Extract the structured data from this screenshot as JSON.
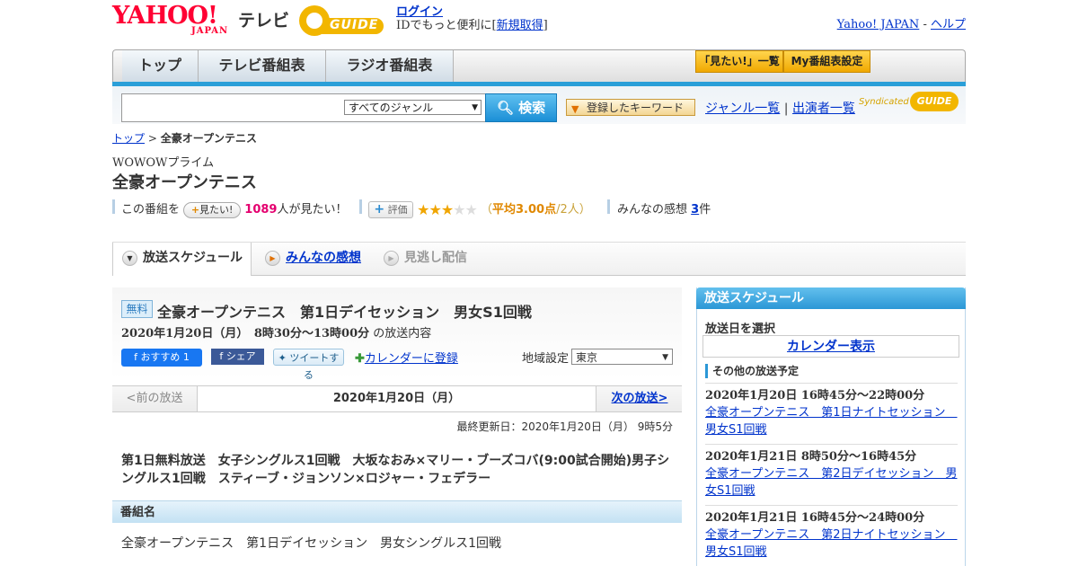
{
  "header": {
    "logo_text": "YAHOO!",
    "logo_sub": "JAPAN",
    "section": "テレビ",
    "gguide_text": "GUIDE",
    "login": "ログイン",
    "login_msg_pre": "IDでもっと便利に[",
    "login_register": "新規取得",
    "login_msg_post": "]",
    "yahoo_japan_link": "Yahoo! JAPAN",
    "separator": "-",
    "help_link": "ヘルプ"
  },
  "nav": {
    "tabs": [
      "トップ",
      "テレビ番組表",
      "ラジオ番組表"
    ],
    "mitai_list": "「見たい!」一覧",
    "my_schedule": "My番組表設定"
  },
  "search": {
    "placeholder": "",
    "genre_select": "すべてのジャンル",
    "search_button": "検索",
    "keyword_button": "登録したキーワード",
    "genre_list": "ジャンル一覧",
    "link_separator": "|",
    "performer_list": "出演者一覧",
    "syndicated": "Syndicated",
    "syndicated_logo": "GUIDE"
  },
  "breadcrumb": {
    "top": "トップ",
    "separator": ">",
    "current": "全豪オープンテニス"
  },
  "program": {
    "channel": "WOWOWプライム",
    "title": "全豪オープンテニス",
    "mitai_prefix": "この番組を",
    "mitai_button": "見たい!",
    "mitai_count": "1089",
    "mitai_suffix": "人が見たい！",
    "rating_button": "評価",
    "rating": 3,
    "rating_max": 5,
    "rating_avg_pre": "（",
    "rating_avg": "平均3.00点",
    "rating_avg_post": "/2人）",
    "comments_prefix": "みんなの感想",
    "comments_count": "3",
    "comments_suffix": "件"
  },
  "tabs": {
    "schedule": "放送スケジュール",
    "impressions": "みんなの感想",
    "missed": "見逃し配信"
  },
  "broadcast": {
    "free_badge": "無料",
    "title": "全豪オープンテニス　第1日デイセッション　男女S1回戦",
    "datetime": "2020年1月20日（月）　8時30分～13時00分",
    "datetime_suffix": "の放送内容",
    "fb_recommend": "おすすめ 1",
    "fb_share": "シェア",
    "tweet": "ツイートする",
    "calendar_register": "カレンダーに登録",
    "region_label": "地域設定",
    "region_value": "東京",
    "prev": "<前の放送",
    "current_date": "2020年1月20日（月）",
    "next": "次の放送>",
    "updated": "最終更新日：2020年1月20日（月）  9時5分",
    "description": "第1日無料放送　女子シングルス1回戦　大坂なおみ×マリー・ブーズコバ(9:00試合開始)男子シングルス1回戦　スティーブ・ジョンソン×ロジャー・フェデラー",
    "section_title": "番組名",
    "section_body": "全豪オープンテニス　第1日デイセッション　男女シングルス1回戦"
  },
  "side": {
    "header": "放送スケジュール",
    "select_date": "放送日を選択",
    "calendar": "カレンダー表示",
    "other_schedule": "その他の放送予定",
    "entries": [
      {
        "date": "2020年1月20日 16時45分～22時00分",
        "title": "全豪オープンテニス　第1日ナイトセッション　男女S1回戦"
      },
      {
        "date": "2020年1月21日 8時50分～16時45分",
        "title": "全豪オープンテニス　第2日デイセッション　男女S1回戦"
      },
      {
        "date": "2020年1月21日 16時45分～24時00分",
        "title": "全豪オープンテニス　第2日ナイトセッション　男女S1回戦"
      }
    ]
  },
  "colors": {
    "accent_blue": "#2a9fd8",
    "yahoo_red": "#ff0033",
    "gguide_yellow": "#f2b600",
    "mitai_count": "#e4006f"
  }
}
